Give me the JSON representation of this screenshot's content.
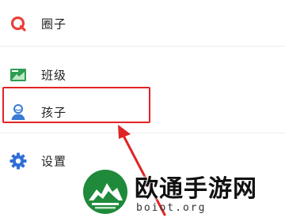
{
  "menu": {
    "items": [
      {
        "label": "圈子",
        "icon": "circle-community-icon"
      },
      {
        "label": "班级",
        "icon": "class-board-icon"
      },
      {
        "label": "孩子",
        "icon": "child-user-icon"
      },
      {
        "label": "设置",
        "icon": "gear-icon"
      }
    ]
  },
  "annotation": {
    "highlight_color": "#e02424"
  },
  "watermark": {
    "title": "欧通手游网",
    "url": "boiot.org"
  },
  "colors": {
    "circle_icon": "#e8413a",
    "class_icon": "#2e9e52",
    "child_icon": "#3a7bd5",
    "settings_icon": "#2f6fd6"
  }
}
